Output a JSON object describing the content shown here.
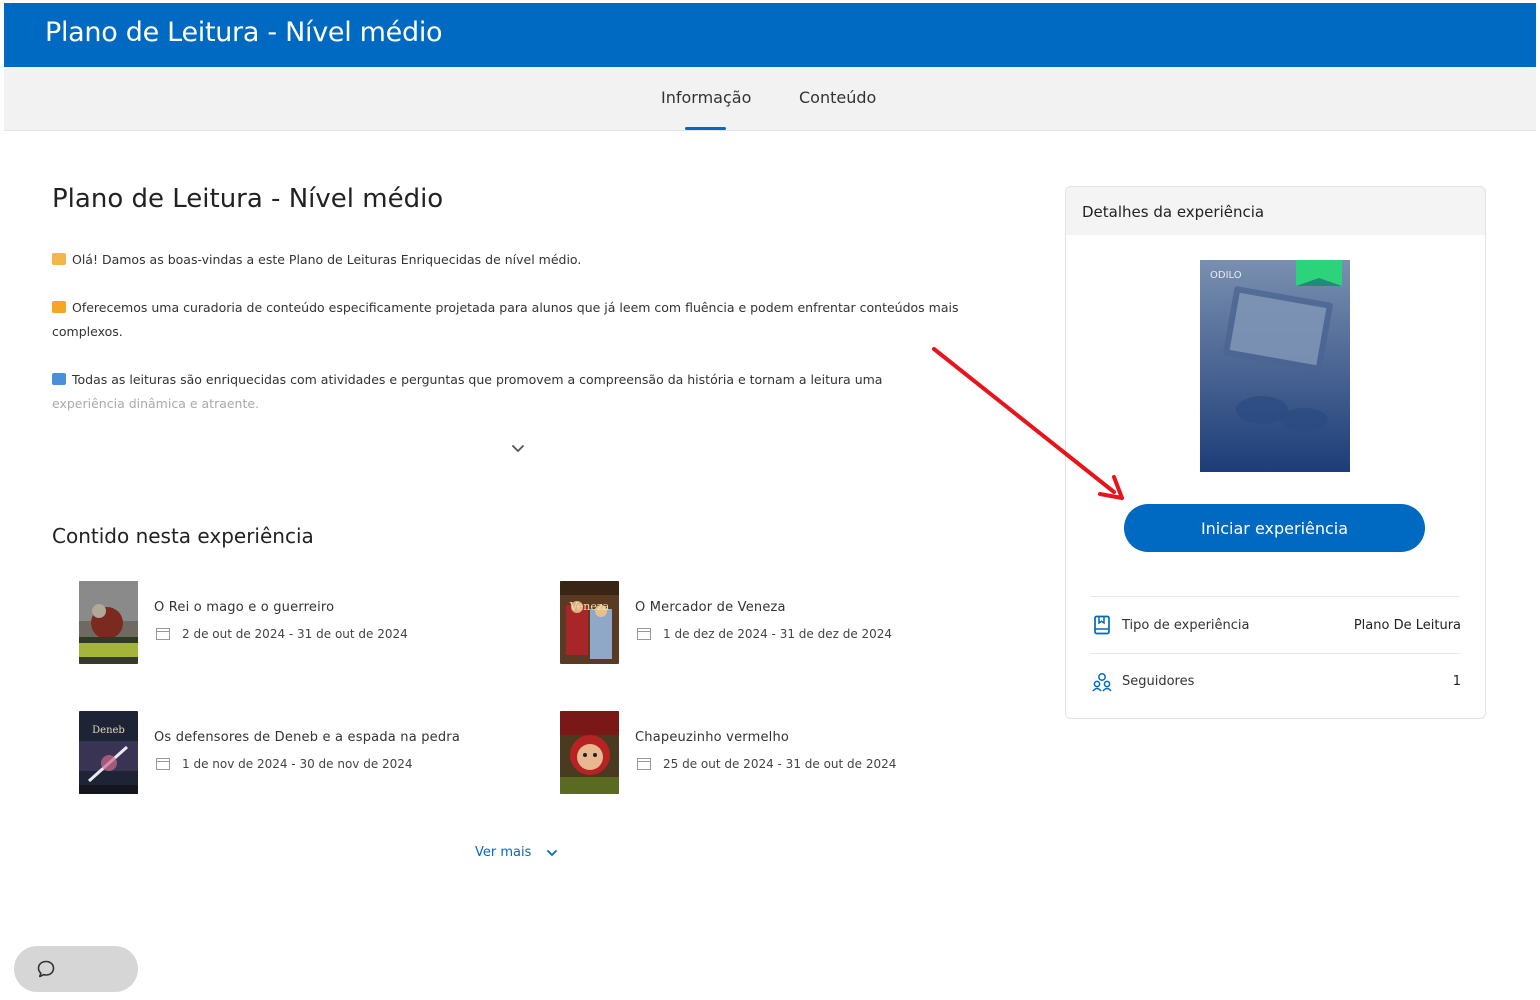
{
  "header": {
    "title": "Plano de Leitura - Nível médio"
  },
  "tabs": [
    {
      "label": "Informação",
      "active": true
    },
    {
      "label": "Conteúdo",
      "active": false
    }
  ],
  "main": {
    "title": "Plano de Leitura - Nível médio",
    "paragraphs": [
      "Olá! Damos as boas-vindas a este Plano de Leituras Enriquecidas de nível médio.",
      "Oferecemos uma curadoria de conteúdo especificamente projetada para alunos que já leem com fluência e podem enfrentar conteúdos mais complexos.",
      "Todas as leituras são enriquecidas com atividades e perguntas que promovem a compreensão da história e tornam a leitura uma",
      "experiência dinâmica e atraente."
    ],
    "section_title": "Contido nesta experiência",
    "items": [
      {
        "name": "O Rei o mago e o guerreiro",
        "dates": "2 de out de 2024 - 31 de out de 2024"
      },
      {
        "name": "O Mercador de Veneza",
        "dates": "1 de dez de 2024 - 31 de dez de 2024",
        "cover_text": "Veneza"
      },
      {
        "name": "Os defensores de Deneb e a espada na pedra",
        "dates": "1 de nov de 2024 - 30 de nov de 2024",
        "cover_text": "Deneb"
      },
      {
        "name": "Chapeuzinho vermelho",
        "dates": "25 de out de 2024 - 31 de out de 2024"
      }
    ],
    "ver_mais": "Ver mais"
  },
  "details": {
    "title": "Detalhes da experiência",
    "cover_brand": "ODILO",
    "start_button": "Iniciar experiência",
    "rows": [
      {
        "label": "Tipo de experiência",
        "value": "Plano De Leitura",
        "icon": "book-icon"
      },
      {
        "label": "Seguidores",
        "value": "1",
        "icon": "followers-icon"
      }
    ]
  },
  "colors": {
    "brand": "#0069c2",
    "annotation_arrow": "#e8141c"
  }
}
